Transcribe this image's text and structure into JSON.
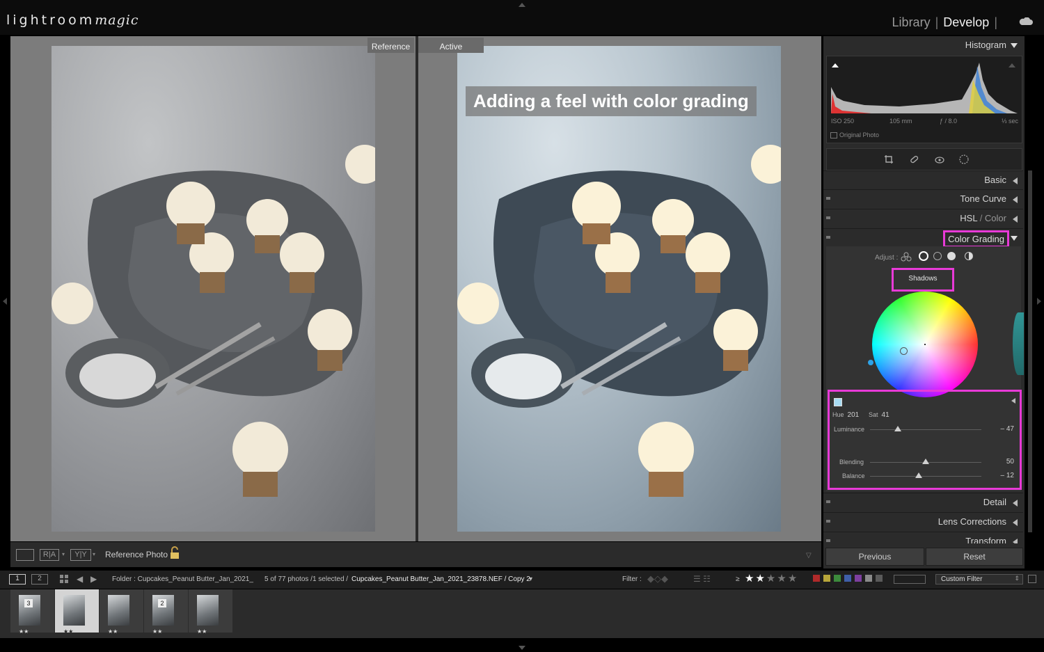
{
  "app": {
    "logo_text": "lightroom",
    "logo_script": "magic",
    "modules": [
      "Library",
      "Develop"
    ],
    "active_module": "Develop"
  },
  "compare": {
    "reference_tag": "Reference",
    "active_tag": "Active",
    "caption": "Adding a feel with color grading"
  },
  "toolbar": {
    "reference_photo_label": "Reference Photo :"
  },
  "histogram": {
    "title": "Histogram",
    "iso": "ISO 250",
    "focal": "105 mm",
    "aperture": "ƒ / 8.0",
    "shutter": "⅓ sec",
    "original_photo": "Original Photo"
  },
  "panels": {
    "basic": "Basic",
    "tone_curve": "Tone Curve",
    "hsl": "HSL",
    "hsl_sep": " / ",
    "color": "Color",
    "color_grading": "Color Grading",
    "detail": "Detail",
    "lens_corrections": "Lens Corrections",
    "transform": "Transform"
  },
  "color_grading": {
    "adjust_label": "Adjust :",
    "mode": "Shadows",
    "hue_label": "Hue",
    "hue_value": "201",
    "sat_label": "Sat",
    "sat_value": "41",
    "luminance_label": "Luminance",
    "luminance_value": "– 47",
    "luminance_level": 0.25,
    "blending_label": "Blending",
    "blending_value": "50",
    "blending_level": 0.5,
    "balance_label": "Balance",
    "balance_value": "– 12",
    "balance_level": 0.44,
    "swatch_color": "#a8dcf2"
  },
  "buttons": {
    "previous": "Previous",
    "reset": "Reset"
  },
  "filmstrip_bar": {
    "page1": "1",
    "page2": "2",
    "folder": "Folder : Cupcakes_Peanut Butter_Jan_2021_",
    "count": "5 of 77 photos /1 selected /",
    "filename": "Cupcakes_Peanut Butter_Jan_2021_23878.NEF / Copy 2",
    "filter_label": "Filter :",
    "gte": "≥",
    "custom_filter": "Custom Filter",
    "color_labels": [
      "#b02a2a",
      "#b7a63a",
      "#3c8a3c",
      "#3f5fa8",
      "#7d3f9e",
      "#8a8a8a",
      "#5a5a5a"
    ],
    "stars_filled": 2,
    "stars_total": 5
  },
  "filmstrip": {
    "thumbs": [
      {
        "badge": "3",
        "stars": "★★"
      },
      {
        "badge": "",
        "stars": "★★"
      },
      {
        "badge": "",
        "stars": "★★"
      },
      {
        "badge": "2",
        "stars": "★★"
      },
      {
        "badge": "",
        "stars": "★★"
      }
    ],
    "selected_index": 1
  }
}
